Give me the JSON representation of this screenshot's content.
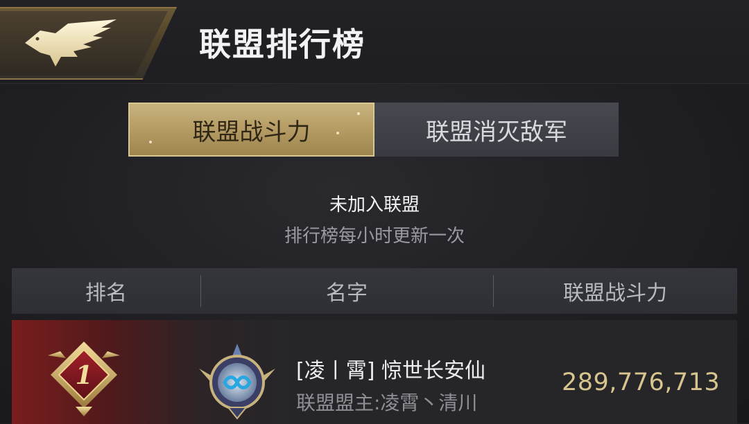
{
  "header": {
    "title": "联盟排行榜"
  },
  "tabs": [
    {
      "label": "联盟战斗力",
      "active": true
    },
    {
      "label": "联盟消灭敌军",
      "active": false
    }
  ],
  "status": {
    "membership": "未加入联盟",
    "update_note": "排行榜每小时更新一次"
  },
  "table": {
    "columns": [
      "排名",
      "名字",
      "联盟战斗力"
    ],
    "rows": [
      {
        "rank": "1",
        "name": "[凌丨霄] 惊世长安仙",
        "leader": "联盟盟主:凌霄丶清川",
        "power": "289,776,713"
      }
    ]
  },
  "colors": {
    "accent_gold": "#c8b37f",
    "power_text": "#d8c48f",
    "rank1_bg": "#7a1d1d"
  },
  "icons": {
    "header": "eagle-emblem-icon",
    "rank": "rank-medal-icon",
    "alliance": "alliance-crest-icon"
  }
}
